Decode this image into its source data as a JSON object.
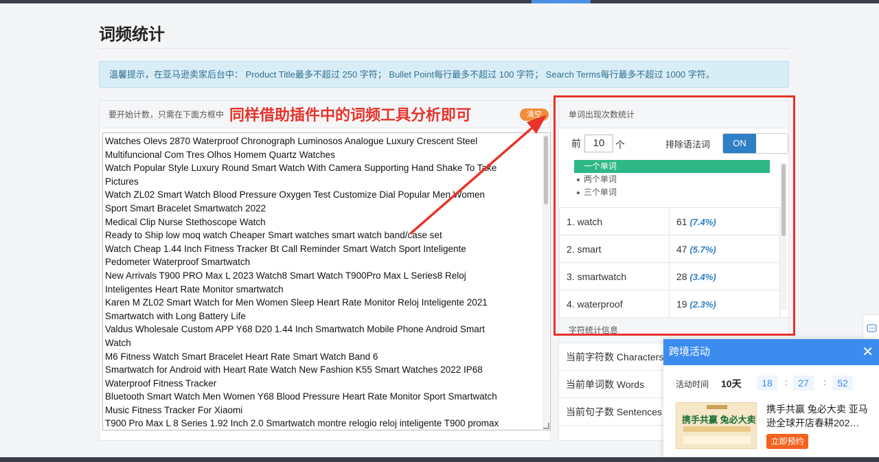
{
  "page": {
    "title": "词频统计"
  },
  "tip": {
    "text": "温馨提示，在亚马逊卖家后台中：   Product Title最多不超过 250 字符；   Bullet Point每行最多不超过 100 字符；   Search Terms每行最多不超过 1000 字符。"
  },
  "input_panel": {
    "header": "要开始计数，只需在下面方框中",
    "clear_label": "清空",
    "lines": [
      "Watches Olevs 2870 Waterproof Chronograph Luminosos Analogue Luxury Crescent Steel",
      "Multifuncional Com Tres Olhos Homem Quartz Watches",
      "Watch Popular Style Luxury Round Smart Watch With Camera Supporting Hand Shake To Take",
      "Pictures",
      "Watch ZL02 Smart Watch Blood Pressure Oxygen Test Customize Dial Popular Men Women",
      "Sport Smart Bracelet Smartwatch 2022",
      "Medical Clip Nurse Stethoscope Watch",
      "Ready to Ship low moq watch Cheaper Smart watches smart watch band/case set",
      "Watch Cheap 1.44 Inch Fitness Tracker Bt Call Reminder Smart Watch Sport Inteligente",
      "Pedometer Waterproof Smartwatch",
      "New Arrivals T900 PRO Max L 2023 Watch8 Smart Watch T900Pro Max L Series8 Reloj",
      "Inteligentes Heart Rate Monitor smartwatch",
      "Karen M ZL02 Smart Watch for Men Women Sleep Heart Rate Monitor Reloj Inteligente 2021",
      "Smartwatch with Long Battery Life",
      "Valdus Wholesale Custom APP Y68 D20 1.44 Inch Smartwatch Mobile Phone Android Smart",
      "Watch",
      "M6 Fitness Watch Smart Bracelet Heart Rate Smart Watch Band 6",
      "Smartwatch for Android with Heart Rate Watch New Fashion K55 Smart Watches 2022 IP68",
      "Waterproof Fitness Tracker",
      "Bluetooth Smart Watch Men Women Y68 Blood Pressure Heart Rate Monitor Sport Smartwatch",
      "Music Fitness Tracker For Xiaomi",
      "T900 Pro Max L 8 Series 1.92 Inch 2.0 Smartwatch montre relogio reloj inteligente T900 promax"
    ]
  },
  "annotation": {
    "text": "同样借助插件中的词频工具分析即可",
    "color": "#e8332a"
  },
  "stats_panel": {
    "header": "单词出现次数统计",
    "top_label": "前",
    "top_value": "10",
    "top_unit": "个",
    "exclude_label": "排除语法词",
    "toggle_state": "ON",
    "word_options": [
      "一个单词",
      "两个单词",
      "三个单词"
    ],
    "selected_option": "一个单词",
    "rows": [
      {
        "word": "1. watch",
        "count": "61",
        "pct": "(7.4%)"
      },
      {
        "word": "2. smart",
        "count": "47",
        "pct": "(5.7%)"
      },
      {
        "word": "3. smartwatch",
        "count": "28",
        "pct": "(3.4%)"
      },
      {
        "word": "4. waterproof",
        "count": "19",
        "pct": "(2.3%)"
      }
    ],
    "char_header": "字符统计信息",
    "char_rows": [
      "当前字符数 Characters",
      "当前单词数 Words",
      "当前句子数 Sentences"
    ]
  },
  "popup": {
    "title": "跨境活动",
    "close": "✕",
    "time_label": "活动时间",
    "days": "10天",
    "hours": "18",
    "minutes": "27",
    "seconds": "52",
    "sep": ":",
    "banner_title": "携手共赢 兔必大卖",
    "promo": "携手共赢 兔必大卖 亚马逊全球开店春耕202…",
    "button": "立即预约"
  },
  "colors": {
    "accent": "#3c8cf0",
    "highlight": "#2fb887",
    "annotation_red": "#e8332a",
    "orange": "#f3611f"
  }
}
